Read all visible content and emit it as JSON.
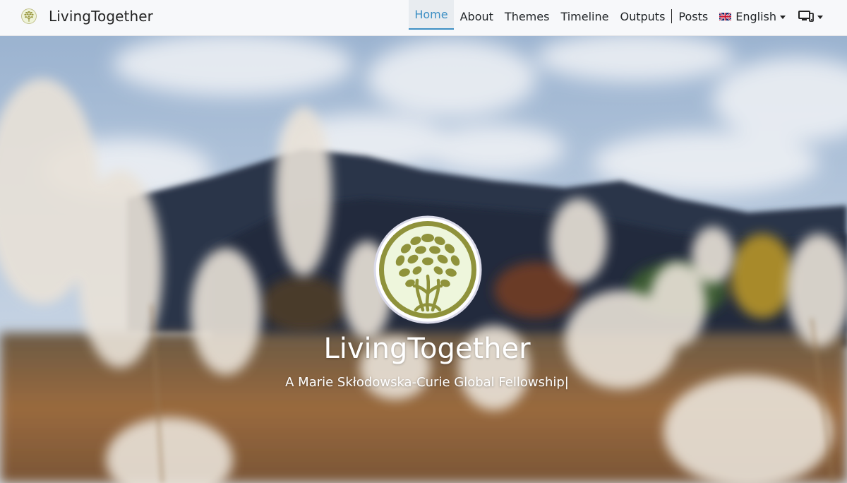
{
  "brand": {
    "name": "LivingTogether",
    "logo_icon": "tree-logo-icon"
  },
  "nav": {
    "items": [
      {
        "label": "Home",
        "active": true
      },
      {
        "label": "About"
      },
      {
        "label": "Themes"
      },
      {
        "label": "Timeline"
      },
      {
        "label": "Outputs"
      },
      {
        "label": "Posts"
      }
    ],
    "language": {
      "label": "English",
      "flag_icon": "uk-flag-icon"
    },
    "theme_toggle_icon": "device-display-icon"
  },
  "hero": {
    "title": "LivingTogether",
    "subtitle": "A Marie Skłodowska-Curie Global Fellowship|",
    "logo_icon": "tree-emblem-icon"
  },
  "colors": {
    "accent": "#3d8fc4",
    "logo_olive": "#8f923b",
    "logo_bg": "#eef6dc",
    "navbar_bg": "#f7f8fa"
  }
}
